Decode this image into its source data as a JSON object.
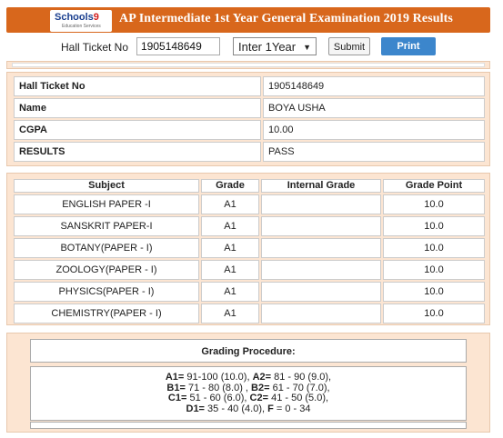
{
  "header": {
    "logo_main": "Schools",
    "logo_accent": "9",
    "logo_sub": "Education Services",
    "title": "AP Intermediate 1st Year General Examination 2019 Results"
  },
  "form": {
    "hall_ticket_label": "Hall Ticket No",
    "hall_ticket_value": "1905148649",
    "year_selected": "Inter 1Year",
    "submit_label": "Submit",
    "print_label": "Print"
  },
  "student": [
    {
      "label": "Hall Ticket No",
      "value": "1905148649"
    },
    {
      "label": "Name",
      "value": "BOYA USHA"
    },
    {
      "label": "CGPA",
      "value": "10.00"
    },
    {
      "label": "RESULTS",
      "value": "PASS"
    }
  ],
  "marks": {
    "headers": [
      "Subject",
      "Grade",
      "Internal Grade",
      "Grade Point"
    ],
    "rows": [
      {
        "subject": "ENGLISH PAPER -I",
        "grade": "A1",
        "internal": "",
        "point": "10.0"
      },
      {
        "subject": "SANSKRIT PAPER-I",
        "grade": "A1",
        "internal": "",
        "point": "10.0"
      },
      {
        "subject": "BOTANY(PAPER - I)",
        "grade": "A1",
        "internal": "",
        "point": "10.0"
      },
      {
        "subject": "ZOOLOGY(PAPER - I)",
        "grade": "A1",
        "internal": "",
        "point": "10.0"
      },
      {
        "subject": "PHYSICS(PAPER - I)",
        "grade": "A1",
        "internal": "",
        "point": "10.0"
      },
      {
        "subject": "CHEMISTRY(PAPER - I)",
        "grade": "A1",
        "internal": "",
        "point": "10.0"
      }
    ]
  },
  "grading": {
    "title": "Grading Procedure:",
    "l1_a": "A1=",
    "l1_b": " 91-100 (10.0), ",
    "l1_c": "A2=",
    "l1_d": " 81 - 90 (9.0),",
    "l2_a": "B1=",
    "l2_b": " 71 - 80 (8.0) , ",
    "l2_c": "B2=",
    "l2_d": " 61 - 70 (7.0),",
    "l3_a": "C1=",
    "l3_b": " 51 - 60 (6.0), ",
    "l3_c": "C2=",
    "l3_d": " 41 - 50 (5.0),",
    "l4_a": "D1=",
    "l4_b": " 35 - 40 (4.0), ",
    "l4_c": "F",
    "l4_d": " = 0 - 34"
  },
  "colors": {
    "header_bg": "#d8671c",
    "panel_bg": "#fce5d2",
    "print_button": "#3c86cc",
    "logo_text": "#1a3f8f"
  }
}
